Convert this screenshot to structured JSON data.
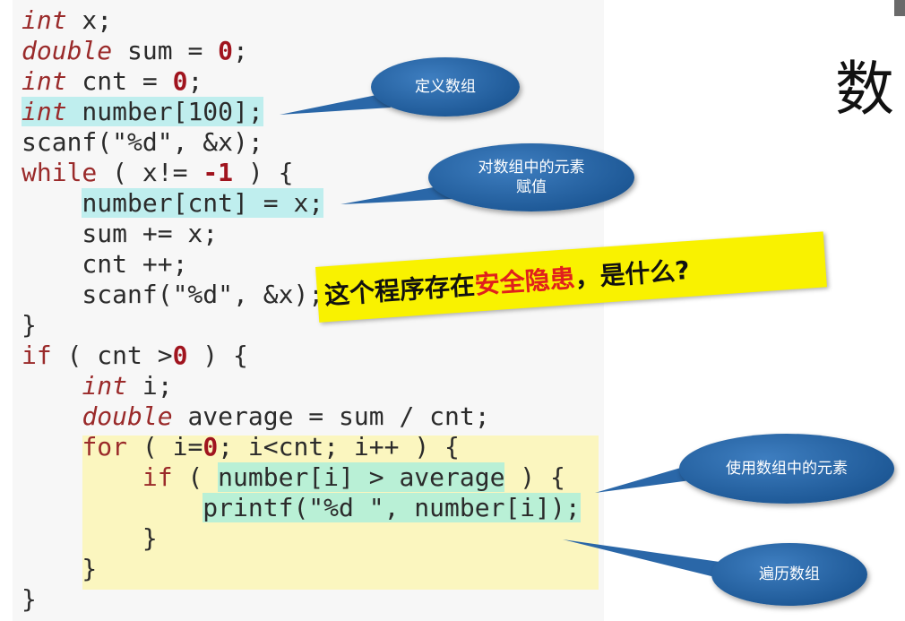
{
  "code_lines": [
    {
      "segments": [
        {
          "text": "int",
          "cls": "kw it"
        },
        {
          "text": " x;",
          "cls": ""
        }
      ]
    },
    {
      "segments": [
        {
          "text": "double",
          "cls": "kw it"
        },
        {
          "text": " sum = ",
          "cls": ""
        },
        {
          "text": "0",
          "cls": "num"
        },
        {
          "text": ";",
          "cls": ""
        }
      ]
    },
    {
      "segments": [
        {
          "text": "int",
          "cls": "kw it"
        },
        {
          "text": " cnt = ",
          "cls": ""
        },
        {
          "text": "0",
          "cls": "num"
        },
        {
          "text": ";",
          "cls": ""
        }
      ]
    },
    {
      "segments": [
        {
          "text": "int",
          "cls": "kw it hl-cyan"
        },
        {
          "text": " number[100];",
          "cls": "hl-cyan"
        }
      ]
    },
    {
      "segments": [
        {
          "text": "scanf(",
          "cls": ""
        },
        {
          "text": "\"%d\"",
          "cls": "str"
        },
        {
          "text": ", &x);",
          "cls": ""
        }
      ]
    },
    {
      "segments": [
        {
          "text": "while",
          "cls": "kw"
        },
        {
          "text": " ( x!= ",
          "cls": ""
        },
        {
          "text": "-1",
          "cls": "num"
        },
        {
          "text": " ) {",
          "cls": ""
        }
      ]
    },
    {
      "segments": [
        {
          "text": "    ",
          "cls": ""
        },
        {
          "text": "number[cnt] = x;",
          "cls": "hl-cyan"
        }
      ]
    },
    {
      "segments": [
        {
          "text": "    sum += x;",
          "cls": ""
        }
      ]
    },
    {
      "segments": [
        {
          "text": "    cnt ++;",
          "cls": ""
        }
      ]
    },
    {
      "segments": [
        {
          "text": "    scanf(",
          "cls": ""
        },
        {
          "text": "\"%d\"",
          "cls": "str"
        },
        {
          "text": ", &x);",
          "cls": ""
        }
      ]
    },
    {
      "segments": [
        {
          "text": "}",
          "cls": ""
        }
      ]
    },
    {
      "segments": [
        {
          "text": "if",
          "cls": "kw"
        },
        {
          "text": " ( cnt >",
          "cls": ""
        },
        {
          "text": "0",
          "cls": "num"
        },
        {
          "text": " ) {",
          "cls": ""
        }
      ]
    },
    {
      "segments": [
        {
          "text": "    ",
          "cls": ""
        },
        {
          "text": "int",
          "cls": "kw it"
        },
        {
          "text": " i;",
          "cls": ""
        }
      ]
    },
    {
      "segments": [
        {
          "text": "    ",
          "cls": ""
        },
        {
          "text": "double",
          "cls": "kw it"
        },
        {
          "text": " average = sum / cnt;",
          "cls": ""
        }
      ]
    },
    {
      "segments": [
        {
          "text": "    ",
          "cls": ""
        },
        {
          "text": "for",
          "cls": "kw"
        },
        {
          "text": " ( i=",
          "cls": ""
        },
        {
          "text": "0",
          "cls": "num"
        },
        {
          "text": "; i<cnt; i++ ) {",
          "cls": ""
        }
      ]
    },
    {
      "segments": [
        {
          "text": "        ",
          "cls": ""
        },
        {
          "text": "if",
          "cls": "kw"
        },
        {
          "text": " ( ",
          "cls": ""
        },
        {
          "text": "number[i] > average",
          "cls": "hl-green"
        },
        {
          "text": " ) {",
          "cls": ""
        }
      ]
    },
    {
      "segments": [
        {
          "text": "            ",
          "cls": ""
        },
        {
          "text": "printf(\"%d \", number[i]);",
          "cls": "hl-green"
        }
      ]
    },
    {
      "segments": [
        {
          "text": "        }",
          "cls": ""
        }
      ]
    },
    {
      "segments": [
        {
          "text": "    }",
          "cls": ""
        }
      ]
    },
    {
      "segments": [
        {
          "text": "}",
          "cls": ""
        }
      ]
    }
  ],
  "callouts": {
    "define_array": "定义数组",
    "assign_line1": "对数组中的元素",
    "assign_line2": "赋值",
    "use_elements": "使用数组中的元素",
    "traverse": "遍历数组"
  },
  "note": {
    "part1": "这个程序存在",
    "part2": "安全隐患",
    "part3": "，是什么?"
  },
  "side_title": "数",
  "colors": {
    "keyword": "#9a2a2a",
    "number": "#a0141e",
    "callout_blue": "#1f5a98",
    "note_yellow": "#f9f200",
    "note_red": "#e0201c",
    "highlight_cyan": "#bfeeee",
    "highlight_green": "#b9f0d6",
    "block_yellow": "#fbf6bf"
  }
}
